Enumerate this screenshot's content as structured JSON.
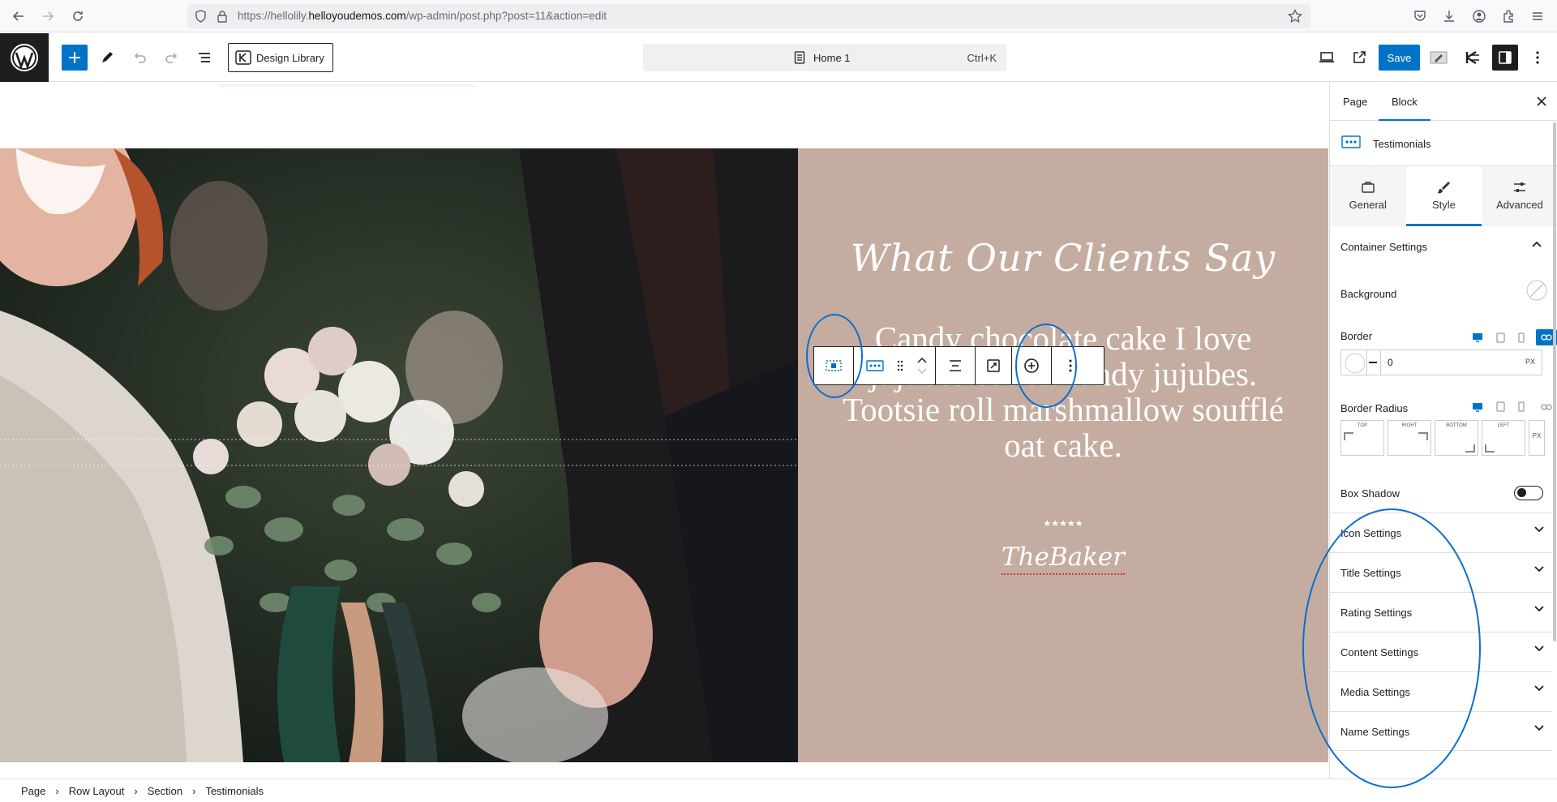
{
  "browser": {
    "url_prefix": "https://hellolily.",
    "url_domain": "helloyoudemos.com",
    "url_path": "/wp-admin/post.php?post=11&action=edit"
  },
  "header": {
    "design_library_label": "Design Library",
    "document_title": "Home 1",
    "shortcut": "Ctrl+K",
    "save_label": "Save"
  },
  "canvas": {
    "title": "What Our Clients Say",
    "content": "Candy chocolate cake I love jujubes cotton candy jujubes. Tootsie roll marshmallow soufflé oat cake.",
    "stars": "★★★★★",
    "rating": 5,
    "name": "TheBaker",
    "panel_color": "#c4aca0"
  },
  "sidebar": {
    "tabs": [
      "Page",
      "Block"
    ],
    "active_tab": "Block",
    "block_name": "Testimonials",
    "style_tabs": [
      "General",
      "Style",
      "Advanced"
    ],
    "active_style_tab": "Style",
    "container_settings_label": "Container Settings",
    "background_label": "Background",
    "border_label": "Border",
    "border_value": "0",
    "border_unit": "PX",
    "border_radius_label": "Border Radius",
    "radius_sides": [
      "TOP",
      "RIGHT",
      "BOTTOM",
      "LEFT"
    ],
    "radius_unit": "PX",
    "box_shadow_label": "Box Shadow",
    "sections": [
      "Icon Settings",
      "Title Settings",
      "Rating Settings",
      "Content Settings",
      "Media Settings",
      "Name Settings"
    ]
  },
  "breadcrumb": [
    "Page",
    "Row Layout",
    "Section",
    "Testimonials"
  ],
  "colors": {
    "accent": "#0073c6",
    "annotation": "#0a6ed1"
  }
}
